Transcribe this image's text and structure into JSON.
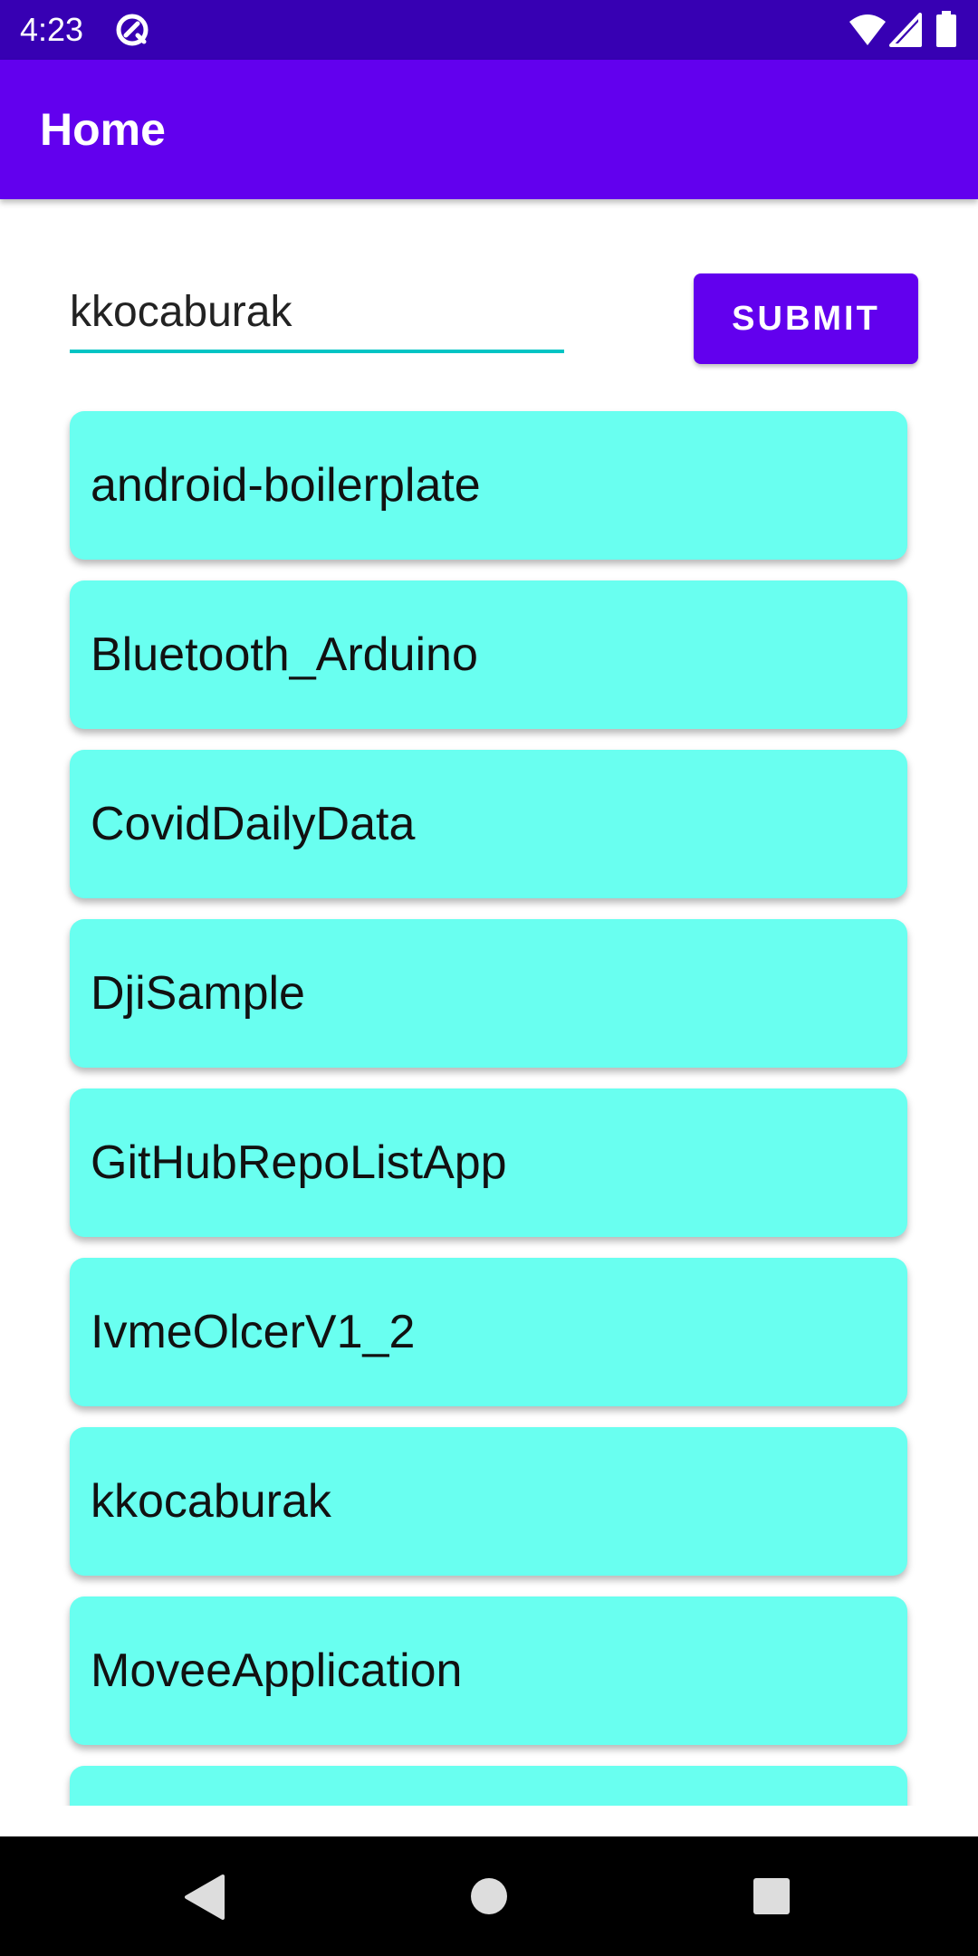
{
  "status_bar": {
    "time": "4:23",
    "icons": [
      "app-notification-icon",
      "wifi-icon",
      "signal-icon",
      "battery-icon"
    ]
  },
  "app_bar": {
    "title": "Home"
  },
  "search": {
    "value": "kkocaburak",
    "submit_label": "SUBMIT"
  },
  "repos": [
    "android-boilerplate",
    "Bluetooth_Arduino",
    "CovidDailyData",
    "DjiSample",
    "GitHubRepoListApp",
    "IvmeOlcerV1_2",
    "kkocaburak",
    "MoveeApplication",
    ""
  ],
  "nav_bar": {
    "icons": [
      "back-icon",
      "home-icon",
      "recents-icon"
    ]
  },
  "colors": {
    "status_bar": "#3700b3",
    "primary": "#6200ee",
    "card": "#69fff0",
    "underline": "#00c4c4"
  }
}
